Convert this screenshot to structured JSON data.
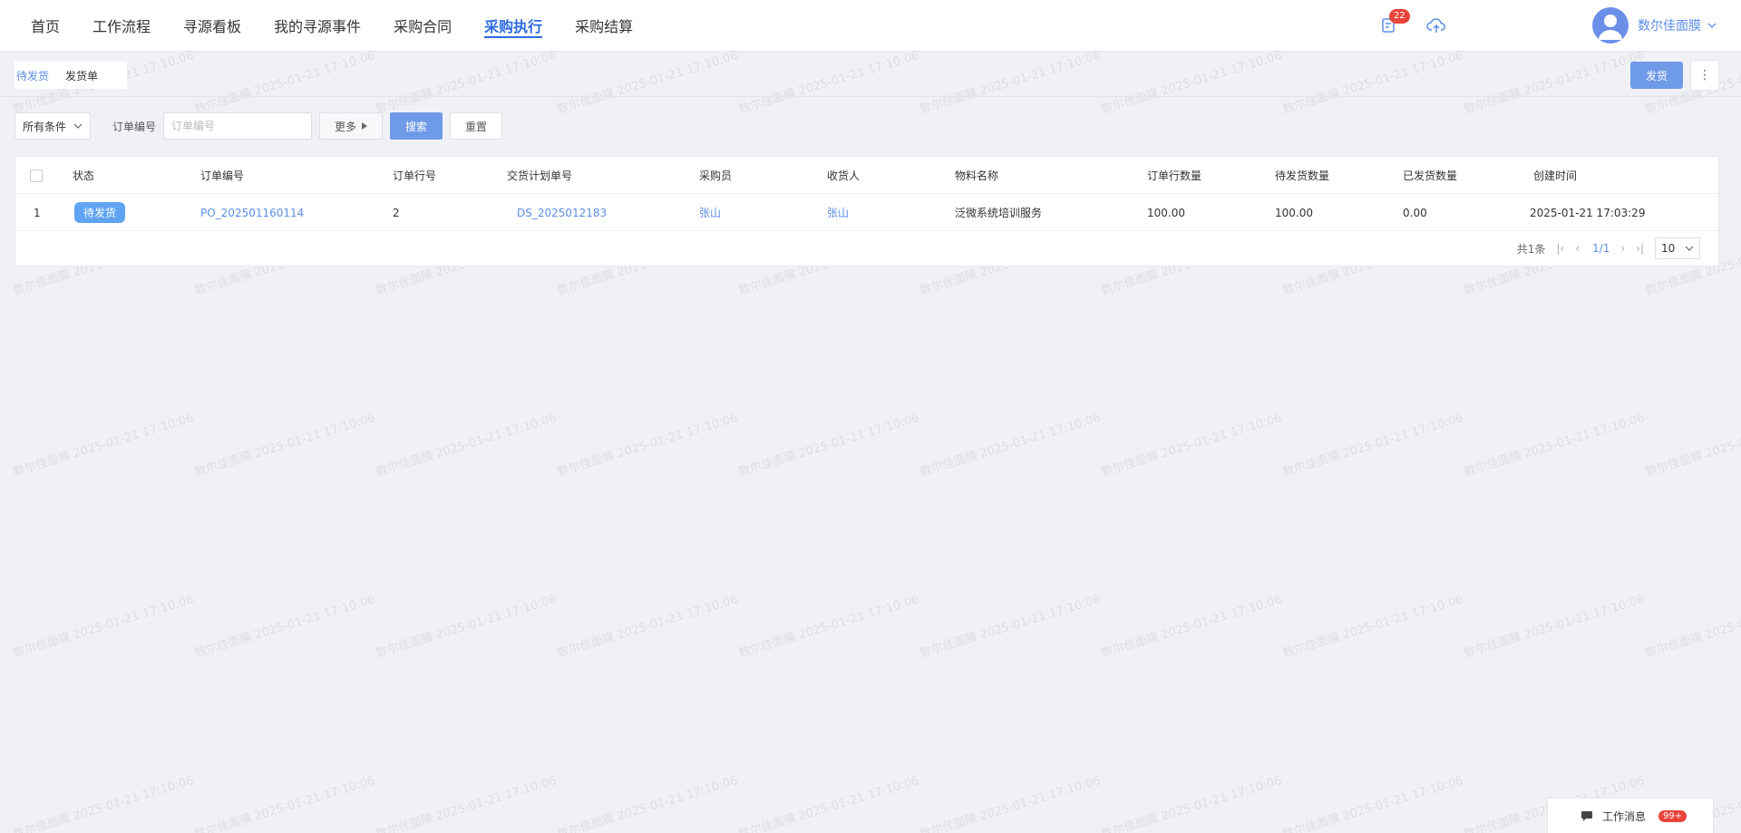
{
  "nav": {
    "items": [
      {
        "label": "首页",
        "active": false
      },
      {
        "label": "工作流程",
        "active": false
      },
      {
        "label": "寻源看板",
        "active": false
      },
      {
        "label": "我的寻源事件",
        "active": false
      },
      {
        "label": "采购合同",
        "active": false
      },
      {
        "label": "采购执行",
        "active": true
      },
      {
        "label": "采购结算",
        "active": false
      }
    ],
    "notification_count": "22",
    "icons": [
      "document-icon",
      "cloud-upload-icon"
    ],
    "username": "数尔佳面膜"
  },
  "subtabs": [
    {
      "label": "待发货",
      "active": true
    },
    {
      "label": "发货单",
      "active": false
    }
  ],
  "actions": {
    "ship_label": "发货",
    "more_label": "⋮"
  },
  "filters": {
    "condition_label": "所有条件",
    "order_no_label": "订单编号",
    "order_no_placeholder": "订单编号",
    "more_label": "更多",
    "search_label": "搜索",
    "reset_label": "重置"
  },
  "table": {
    "columns": [
      "状态",
      "订单编号",
      "订单行号",
      "交货计划单号",
      "采购员",
      "收货人",
      "物料名称",
      "订单行数量",
      "待发货数量",
      "已发货数量",
      "创建时间"
    ],
    "rows": [
      {
        "index": "1",
        "status": "待发货",
        "order_no": "PO_202501160114",
        "line_no": "2",
        "plan_no": "DS_2025012183",
        "buyer": "张山",
        "receiver": "张山",
        "material": "泛微系统培训服务",
        "line_qty": "100.00",
        "pending_qty": "100.00",
        "shipped_qty": "0.00",
        "created": "2025-01-21 17:03:29"
      }
    ]
  },
  "pager": {
    "total": "共1条",
    "current": "1/1",
    "page_size": "10"
  },
  "message_widget": {
    "label": "工作消息",
    "count": "99+"
  },
  "watermark": {
    "text": "数尔佳面膜  2025-01-21 17:10:06"
  },
  "colors": {
    "accent": "#2d6be0",
    "link": "#5b8ee6",
    "primary_button": "#6e9ae8",
    "badge": "#e8443a",
    "status_tag": "#5fa4f2"
  }
}
